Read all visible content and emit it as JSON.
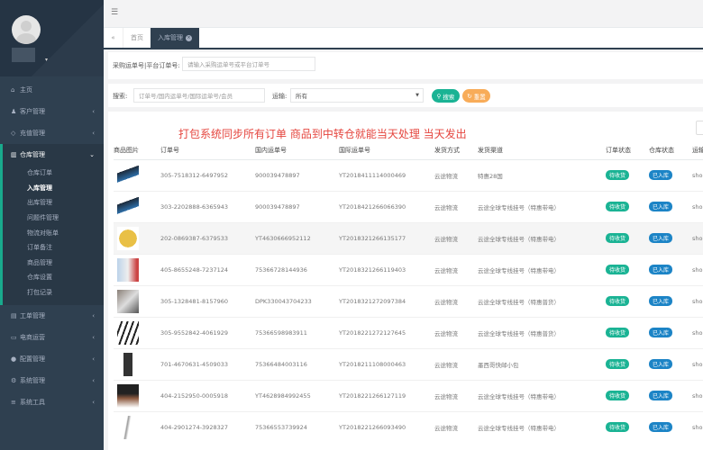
{
  "sidebar": {
    "items_top": [
      {
        "label": "主页",
        "icon": "home-icon"
      },
      {
        "label": "客户管理",
        "icon": "user-icon"
      },
      {
        "label": "充值管理",
        "icon": "diamond-icon"
      }
    ],
    "group": {
      "label": "仓库管理",
      "icon": "bank-icon",
      "subitems": [
        "仓库订单",
        "入库管理",
        "出库管理",
        "问题件管理",
        "物流对账单",
        "订单备注",
        "商品管理",
        "仓库设置",
        "打包记录"
      ],
      "active": "入库管理"
    },
    "items_bottom": [
      {
        "label": "工单管理",
        "icon": "ticket-icon"
      },
      {
        "label": "电商运营",
        "icon": "desktop-icon"
      },
      {
        "label": "配置管理",
        "icon": "circle-icon"
      },
      {
        "label": "系统管理",
        "icon": "gear-icon"
      },
      {
        "label": "系统工具",
        "icon": "list-icon"
      }
    ]
  },
  "tabs": [
    {
      "label": "首页"
    },
    {
      "label": "入库管理"
    }
  ],
  "filter1": {
    "label": "采购运单号|平台订单号:",
    "placeholder": "请输入采购运单号或平台订单号"
  },
  "filter2": {
    "search_label": "搜索:",
    "search_placeholder": "订单号/国内运单号/国际运单号/会员",
    "carrier_label": "运输:",
    "carrier_value": "所有",
    "search_button": "搜索",
    "reset_button": "重置"
  },
  "notice": "打包系统同步所有订单 商品到中转仓就能当天处理 当天发出",
  "colors": {
    "sidebar": "#2f4050",
    "accent": "#19aa8d",
    "order_status": "#1ab394",
    "warehouse_status": "#1c84c6",
    "reset": "#f8ac59",
    "notice": "#e5463f"
  },
  "table": {
    "headers": [
      "商品图片",
      "订单号",
      "国内运单号",
      "国际运单号",
      "发货方式",
      "发货渠道",
      "订单状态",
      "仓库状态",
      "运输"
    ],
    "rows": [
      {
        "order": "305-7518312-6497952",
        "domestic": "900039478897",
        "intl": "YT2018411114000469",
        "method": "云途物流",
        "channel": "特惠28国",
        "order_status": "待收货",
        "wh_status": "已入库",
        "extra": "sho"
      },
      {
        "order": "303-2202888-6365943",
        "domestic": "900039478897",
        "intl": "YT2018421266066390",
        "method": "云途物流",
        "channel": "云途全球专线挂号（特惠带电）",
        "order_status": "待收货",
        "wh_status": "已入库",
        "extra": "sho"
      },
      {
        "order": "202-0869387-6379533",
        "domestic": "YT4630666952112",
        "intl": "YT2018321266135177",
        "method": "云途物流",
        "channel": "云途全球专线挂号（特惠带电）",
        "order_status": "待收货",
        "wh_status": "已入库",
        "extra": "sho"
      },
      {
        "order": "405-8655248-7237124",
        "domestic": "75366728144936",
        "intl": "YT2018321266119403",
        "method": "云途物流",
        "channel": "云途全球专线挂号（特惠带电）",
        "order_status": "待收货",
        "wh_status": "已入库",
        "extra": "sho"
      },
      {
        "order": "305-1328481-8157960",
        "domestic": "DPK330043704233",
        "intl": "YT2018321272097384",
        "method": "云途物流",
        "channel": "云途全球专线挂号（特惠普货）",
        "order_status": "待收货",
        "wh_status": "已入库",
        "extra": "sho"
      },
      {
        "order": "305-9552842-4061929",
        "domestic": "75366598983911",
        "intl": "YT2018221272127645",
        "method": "云途物流",
        "channel": "云途全球专线挂号（特惠普货）",
        "order_status": "待收货",
        "wh_status": "已入库",
        "extra": "sho"
      },
      {
        "order": "701-4670631-4509033",
        "domestic": "75366484003116",
        "intl": "YT2018211108000463",
        "method": "云途物流",
        "channel": "墨西哥快邮小包",
        "order_status": "待收货",
        "wh_status": "已入库",
        "extra": "sho"
      },
      {
        "order": "404-2152950-0005918",
        "domestic": "YT4628984992455",
        "intl": "YT2018221266127119",
        "method": "云途物流",
        "channel": "云途全球专线挂号（特惠带电）",
        "order_status": "待收货",
        "wh_status": "已入库",
        "extra": "sho"
      },
      {
        "order": "404-2901274-3928327",
        "domestic": "75366553739924",
        "intl": "YT2018221266093490",
        "method": "云途物流",
        "channel": "云途全球专线挂号（特惠带电）",
        "order_status": "待收货",
        "wh_status": "已入库",
        "extra": "sho"
      }
    ]
  }
}
